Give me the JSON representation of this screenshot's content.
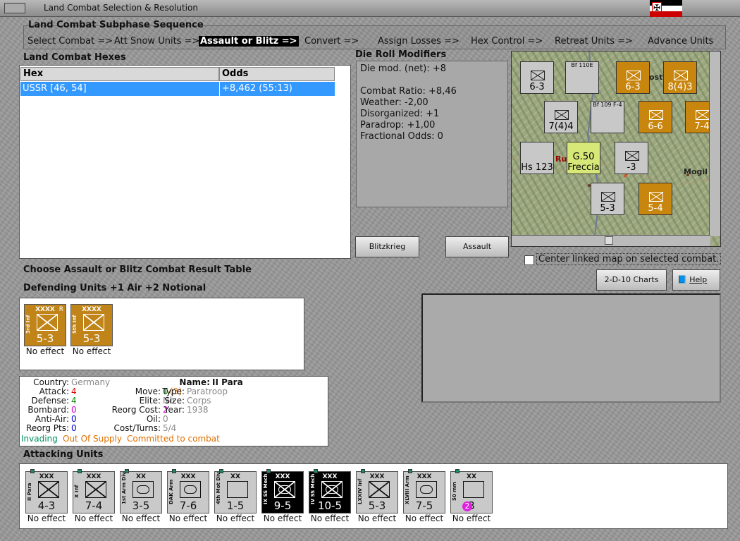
{
  "window": {
    "title": "Land Combat Selection & Resolution"
  },
  "subphase": {
    "title": "Land Combat Subphase Sequence",
    "steps": [
      "Select Combat =>",
      "Att Snow Units =>",
      "Assault or Blitz =>",
      "Convert =>",
      "Assign Losses =>",
      "Hex Control =>",
      "Retreat Units =>",
      "Advance Units"
    ],
    "active_index": 2
  },
  "hexes": {
    "title": "Land Combat Hexes",
    "columns": [
      "Hex",
      "Odds"
    ],
    "rows": [
      [
        "USSR [46, 54]",
        "+8,462 (55:13)"
      ]
    ]
  },
  "drm": {
    "title": "Die Roll Modifiers",
    "lines": [
      "Die mod. (net): +8",
      "",
      "Combat Ratio: +8,46",
      "Weather: -2,00",
      "Disorganized: +1",
      "Paradrop: +1,00",
      "Fractional Odds: 0"
    ]
  },
  "buttons": {
    "blitz": "Blitzkrieg",
    "assault": "Assault",
    "charts": "2-D-10 Charts",
    "help": "Help"
  },
  "map": {
    "center_label": "Center linked map on selected combat.",
    "labels": [
      "Mogil",
      "Ru",
      "ost"
    ],
    "units": [
      {
        "str": "6-3",
        "type": "xxx",
        "color": "g"
      },
      {
        "str": "5",
        "type": "Bf 110E",
        "color": "g"
      },
      {
        "str": "6-3",
        "type": "xxx",
        "color": "o"
      },
      {
        "str": "8(4)3",
        "type": "xxxxx",
        "color": "o"
      },
      {
        "str": "7(4)4",
        "type": "xxxxx",
        "color": "g"
      },
      {
        "str": "Bf 109 F-4",
        "type": "",
        "color": "g"
      },
      {
        "str": "6-6",
        "type": "xxx",
        "color": "o"
      },
      {
        "str": "7-4",
        "type": "xxx",
        "color": "o"
      },
      {
        "str": "Hs 123",
        "type": "",
        "color": "g"
      },
      {
        "str": "G.50 Freccia",
        "type": "",
        "color": "y"
      },
      {
        "str": "-3",
        "type": "xxx",
        "color": "g"
      },
      {
        "str": "5-3",
        "type": "xxx",
        "color": "g"
      },
      {
        "str": "5-4",
        "type": "xxx",
        "color": "o"
      }
    ]
  },
  "result_table": {
    "title": "Choose Assault or Blitz Combat Result Table"
  },
  "defenders": {
    "title": "Defending Units +1 Air +2 Notional",
    "units": [
      {
        "name": "3rd Inf",
        "size": "XXXX",
        "str": "5-3",
        "mark": "R",
        "effect": "No effect"
      },
      {
        "name": "5th Inf",
        "size": "XXXX",
        "str": "5-3",
        "mark": "",
        "effect": "No effect"
      }
    ]
  },
  "info": {
    "country_label": "Country:",
    "country": "Germany",
    "attack_label": "Attack:",
    "attack": "4",
    "defense_label": "Defense:",
    "defense": "4",
    "bombard_label": "Bombard:",
    "bombard": "0",
    "antiair_label": "Anti-Air:",
    "antiair": "0",
    "reorgpts_label": "Reorg Pts:",
    "reorgpts": "0",
    "move_label": "Move:",
    "move": "0",
    "move_extra": "(3)",
    "elite_label": "Elite:",
    "elite": "No",
    "reorgcost_label": "Reorg Cost:",
    "reorgcost": "2",
    "oil_label": "Oil:",
    "oil": "0",
    "costturns_label": "Cost/Turns:",
    "costturns": "5/4",
    "name_label": "Name:",
    "name": "II Para",
    "type_label": "Type:",
    "type": "Paratroop",
    "size_label": "Size:",
    "size": "Corps",
    "year_label": "Year:",
    "year": "1938",
    "status": [
      "Invading",
      "Out Of Supply",
      "Committed to combat"
    ],
    "colors": {
      "red": "#e00000",
      "green": "#0a8a0a",
      "magenta": "#d000d0",
      "orange": "#e07000",
      "teal": "#009060",
      "grey": "#888888"
    }
  },
  "attackers": {
    "title": "Attacking Units",
    "units": [
      {
        "name": "II Para",
        "size": "XXX",
        "str": "4-3",
        "kind": "para",
        "color": "g",
        "effect": "No effect"
      },
      {
        "name": "X Inf",
        "size": "XXX",
        "str": "7-4",
        "kind": "inf",
        "color": "g",
        "effect": "No effect"
      },
      {
        "name": "1st Arm Div",
        "size": "XX",
        "str": "3-5",
        "kind": "arm",
        "color": "g",
        "effect": "No effect"
      },
      {
        "name": "DAK Arm",
        "size": "XXX",
        "str": "7-6",
        "kind": "arm",
        "color": "g",
        "effect": "No effect"
      },
      {
        "name": "4th Mot Div",
        "size": "XX",
        "str": "1-5",
        "kind": "mot",
        "color": "g",
        "effect": "No effect"
      },
      {
        "name": "IX SS Mech",
        "size": "XXX",
        "str": "9-5",
        "kind": "mech",
        "color": "b",
        "effect": "No effect"
      },
      {
        "name": "IV SS Mech",
        "size": "XXX",
        "str": "10-5",
        "kind": "mech",
        "color": "b",
        "effect": "No effect"
      },
      {
        "name": "LXXIV Inf",
        "size": "XXX",
        "str": "5-3",
        "kind": "inf",
        "color": "g",
        "effect": "No effect"
      },
      {
        "name": "XLVIII Arm",
        "size": "XXX",
        "str": "7-5",
        "kind": "arm",
        "color": "g",
        "effect": "No effect"
      },
      {
        "name": "50 mm",
        "size": "XX",
        "str": "3",
        "kind": "art",
        "color": "g",
        "effect": "No effect",
        "badge": "2"
      }
    ]
  }
}
